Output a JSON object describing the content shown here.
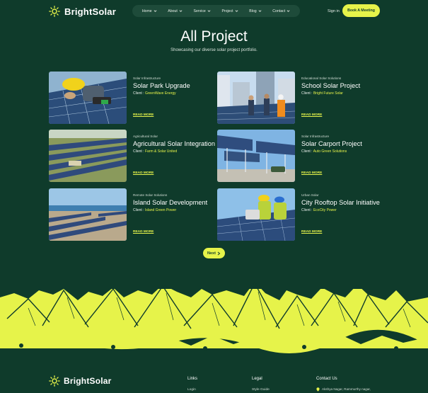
{
  "brand": {
    "name": "BrightSolar",
    "accent": "#e6f34a",
    "bg": "#0f3b2b"
  },
  "nav": {
    "items": [
      {
        "label": "Home"
      },
      {
        "label": "About"
      },
      {
        "label": "Service"
      },
      {
        "label": "Project"
      },
      {
        "label": "Blog"
      },
      {
        "label": "Contact"
      }
    ],
    "signin": "Sign in",
    "book": "Book A Meeting"
  },
  "hero": {
    "title": "All Project",
    "subtitle": "Showcasing our diverse solar project portfolio."
  },
  "projects": [
    {
      "category": "Solar Infrastructure",
      "title": "Solar Park Upgrade",
      "client_label": "Client :",
      "client": "GreenWave Energy",
      "read_more": "READ MORE",
      "image": "worker-installing-solar-panel"
    },
    {
      "category": "Educational Solar Solutions",
      "title": "School Solar Project",
      "client_label": "Client :",
      "client": "Bright Future Solar",
      "read_more": "READ MORE",
      "image": "engineers-on-rooftop"
    },
    {
      "category": "Agricultural Solar",
      "title": "Agricultural Solar Integration",
      "client_label": "Client :",
      "client": "Farm & Solar United",
      "read_more": "READ MORE",
      "image": "solar-farm-rows"
    },
    {
      "category": "Solar Infrastructure",
      "title": "Solar Carport Project",
      "client_label": "Client :",
      "client": "Auto Green Solutions",
      "read_more": "READ MORE",
      "image": "solar-carport"
    },
    {
      "category": "Remote Solar Solutions",
      "title": "Island Solar Development",
      "client_label": "Client :",
      "client": "Island Green Power",
      "read_more": "READ MORE",
      "image": "coastal-solar-field"
    },
    {
      "category": "Urban Solar",
      "title": "City Rooftop Solar Initiative",
      "client_label": "Client :",
      "client": "EcoCity Power",
      "read_more": "READ MORE",
      "image": "workers-on-rooftop-panels"
    }
  ],
  "pagination": {
    "next": "Next"
  },
  "footer": {
    "brand": "BrightSolar",
    "links_title": "Links",
    "links_first": "Login",
    "legal_title": "Legal",
    "legal_first": "Style Guide",
    "contact_title": "Contact Us",
    "address": "Akshya Nagar, Rammurthy nagar,"
  }
}
